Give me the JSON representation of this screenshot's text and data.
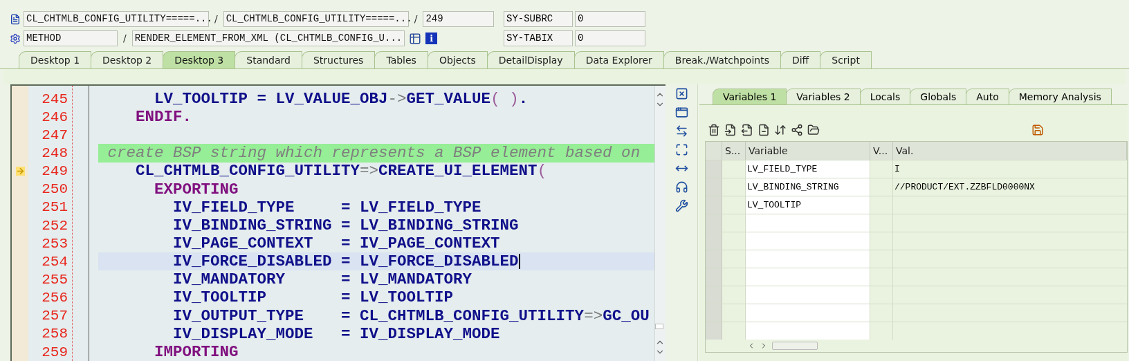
{
  "header": {
    "rows": [
      {
        "items": [
          {
            "kind": "field",
            "text": "CL_CHTMLB_CONFIG_UTILITY=====..."
          },
          {
            "kind": "sep",
            "text": "/"
          },
          {
            "kind": "field",
            "text": "CL_CHTMLB_CONFIG_UTILITY=====..."
          },
          {
            "kind": "sep",
            "text": "/"
          },
          {
            "kind": "short",
            "text": "249"
          }
        ],
        "sysvar_name": "SY-SUBRC",
        "sysvar_value": "0"
      },
      {
        "items": [
          {
            "kind": "short",
            "text": "METHOD"
          },
          {
            "kind": "sep",
            "text": "/"
          },
          {
            "kind": "field",
            "text": "RENDER_ELEMENT_FROM_XML (CL_CHTMLB_CONFIG_U..."
          },
          {
            "kind": "tools",
            "text": "i"
          }
        ],
        "sysvar_name": "SY-TABIX",
        "sysvar_value": "0"
      }
    ]
  },
  "tabs": [
    {
      "label": "Desktop 1",
      "selected": false
    },
    {
      "label": "Desktop 2",
      "selected": false
    },
    {
      "label": "Desktop 3",
      "selected": true
    },
    {
      "label": "Standard",
      "selected": false
    },
    {
      "label": "Structures",
      "selected": false
    },
    {
      "label": "Tables",
      "selected": false
    },
    {
      "label": "Objects",
      "selected": false
    },
    {
      "label": "DetailDisplay",
      "selected": false
    },
    {
      "label": "Data Explorer",
      "selected": false
    },
    {
      "label": "Break./Watchpoints",
      "selected": false
    },
    {
      "label": "Diff",
      "selected": false
    },
    {
      "label": "Script",
      "selected": false
    }
  ],
  "editor": {
    "lines": [
      {
        "number": "245",
        "current": false,
        "highlighted": false,
        "tokens": [
          {
            "text": "      LV_TOOLTIP = LV_VALUE_OBJ",
            "kind": "ident"
          },
          {
            "text": "->",
            "kind": "op"
          },
          {
            "text": "GET_VALUE",
            "kind": "ident"
          },
          {
            "text": "( )",
            "kind": "paren"
          },
          {
            "text": ".",
            "kind": "ident"
          }
        ]
      },
      {
        "number": "246",
        "current": false,
        "highlighted": false,
        "tokens": [
          {
            "text": "    ENDIF.",
            "kind": "keyword"
          }
        ]
      },
      {
        "number": "247",
        "current": false,
        "highlighted": false
      },
      {
        "number": "248",
        "current": false,
        "highlighted": false,
        "tokens": [
          {
            "text": " create BSP string which represents a BSP element based on",
            "kind": "comment"
          }
        ]
      },
      {
        "number": "249",
        "current": true,
        "highlighted": false,
        "tokens": [
          {
            "text": "    CL_CHTMLB_CONFIG_UTILITY",
            "kind": "ident"
          },
          {
            "text": "=>",
            "kind": "op"
          },
          {
            "text": "CREATE_UI_ELEMENT",
            "kind": "ident"
          },
          {
            "text": "(",
            "kind": "paren"
          }
        ]
      },
      {
        "number": "250",
        "current": false,
        "highlighted": false,
        "tokens": [
          {
            "text": "      EXPORTING",
            "kind": "keyword"
          }
        ]
      },
      {
        "number": "251",
        "current": false,
        "highlighted": false,
        "tokens": [
          {
            "text": "        IV_FIELD_TYPE     = LV_FIELD_TYPE",
            "kind": "ident"
          }
        ]
      },
      {
        "number": "252",
        "current": false,
        "highlighted": false,
        "tokens": [
          {
            "text": "        IV_BINDING_STRING = LV_BINDING_STRING",
            "kind": "ident"
          }
        ]
      },
      {
        "number": "253",
        "current": false,
        "highlighted": false,
        "tokens": [
          {
            "text": "        IV_PAGE_CONTEXT   = IV_PAGE_CONTEXT",
            "kind": "ident"
          }
        ]
      },
      {
        "number": "254",
        "current": false,
        "highlighted": true,
        "tokens": [
          {
            "text": "        IV_FORCE_DISABLED = LV_FORCE_DISABLED",
            "kind": "ident"
          }
        ]
      },
      {
        "number": "255",
        "current": false,
        "highlighted": false,
        "tokens": [
          {
            "text": "        IV_MANDATORY      = LV_MANDATORY",
            "kind": "ident"
          }
        ]
      },
      {
        "number": "256",
        "current": false,
        "highlighted": false,
        "tokens": [
          {
            "text": "        IV_TOOLTIP        = LV_TOOLTIP",
            "kind": "ident"
          }
        ]
      },
      {
        "number": "257",
        "current": false,
        "highlighted": false,
        "tokens": [
          {
            "text": "        IV_OUTPUT_TYPE    = CL_CHTMLB_CONFIG_UTILITY",
            "kind": "ident"
          },
          {
            "text": "=>",
            "kind": "op"
          },
          {
            "text": "GC_OU",
            "kind": "ident"
          }
        ]
      },
      {
        "number": "258",
        "current": false,
        "highlighted": false,
        "tokens": [
          {
            "text": "        IV_DISPLAY_MODE   = IV_DISPLAY_MODE",
            "kind": "ident"
          }
        ]
      },
      {
        "number": "259",
        "current": false,
        "highlighted": false,
        "tokens": [
          {
            "text": "      IMPORTING",
            "kind": "keyword"
          }
        ]
      }
    ]
  },
  "variables": {
    "tabs": [
      {
        "label": "Variables 1",
        "selected": true
      },
      {
        "label": "Variables 2",
        "selected": false
      },
      {
        "label": "Locals",
        "selected": false
      },
      {
        "label": "Globals",
        "selected": false
      },
      {
        "label": "Auto",
        "selected": false
      },
      {
        "label": "Memory Analysis",
        "selected": false
      }
    ],
    "table": {
      "columns": [
        "S...",
        "Variable",
        "V...",
        "Val."
      ],
      "rows": [
        {
          "variable": "LV_FIELD_TYPE",
          "value": "I"
        },
        {
          "variable": "LV_BINDING_STRING",
          "value": "//PRODUCT/EXT.ZZBFLD0000NX"
        },
        {
          "variable": "LV_TOOLTIP"
        }
      ]
    }
  }
}
